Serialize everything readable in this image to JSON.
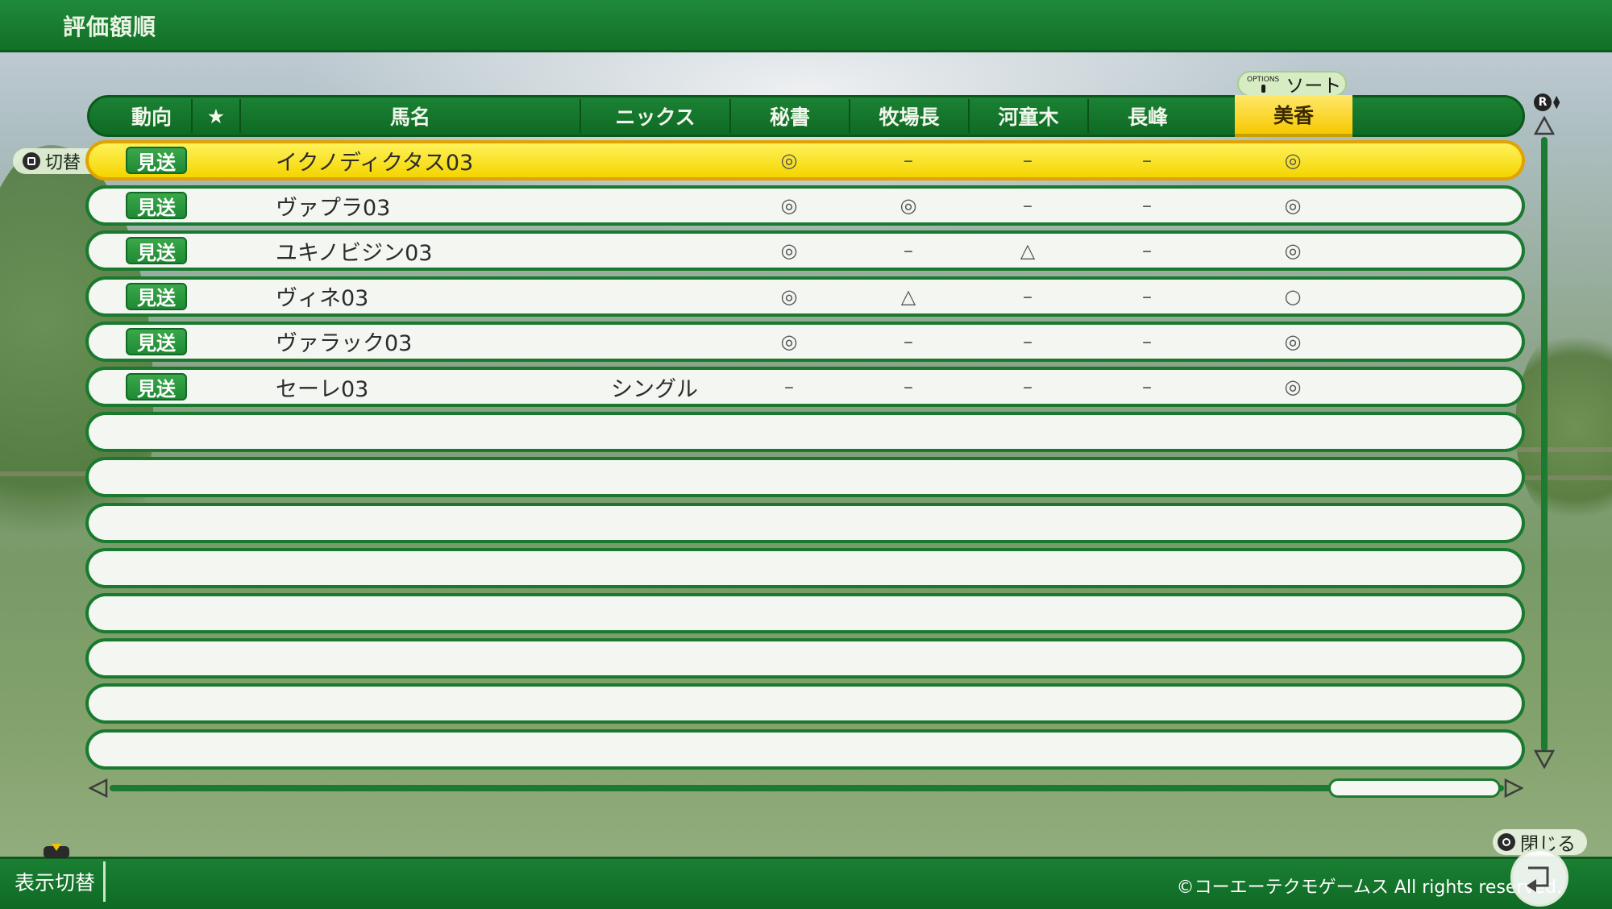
{
  "title": "評価額順",
  "sort": {
    "options_label": "OPTIONS",
    "label": "ソート"
  },
  "switch_hint": "切替",
  "columns": [
    "動向",
    "★",
    "馬名",
    "ニックス",
    "秘書",
    "牧場長",
    "河童木",
    "長峰",
    "美香"
  ],
  "active_column": "美香",
  "rows": [
    {
      "status": "見送",
      "name": "イクノディクタス03",
      "nicks": "",
      "marks": [
        "◎",
        "–",
        "–",
        "–",
        "◎"
      ],
      "selected": true
    },
    {
      "status": "見送",
      "name": "ヴァプラ03",
      "nicks": "",
      "marks": [
        "◎",
        "◎",
        "–",
        "–",
        "◎"
      ]
    },
    {
      "status": "見送",
      "name": "ユキノビジン03",
      "nicks": "",
      "marks": [
        "◎",
        "–",
        "△",
        "–",
        "◎"
      ]
    },
    {
      "status": "見送",
      "name": "ヴィネ03",
      "nicks": "",
      "marks": [
        "◎",
        "△",
        "–",
        "–",
        "○"
      ]
    },
    {
      "status": "見送",
      "name": "ヴァラック03",
      "nicks": "",
      "marks": [
        "◎",
        "–",
        "–",
        "–",
        "◎"
      ]
    },
    {
      "status": "見送",
      "name": "セーレ03",
      "nicks": "シングル",
      "marks": [
        "–",
        "–",
        "–",
        "–",
        "◎"
      ]
    }
  ],
  "empty_rows": 8,
  "footer": {
    "view_toggle": "表示切替",
    "close_label": "閉じる",
    "copyright": "©コーエーテクモゲームス All rights reserved."
  },
  "r_button": "R",
  "colors": {
    "green": "#127027",
    "highlight": "#f4d500"
  }
}
